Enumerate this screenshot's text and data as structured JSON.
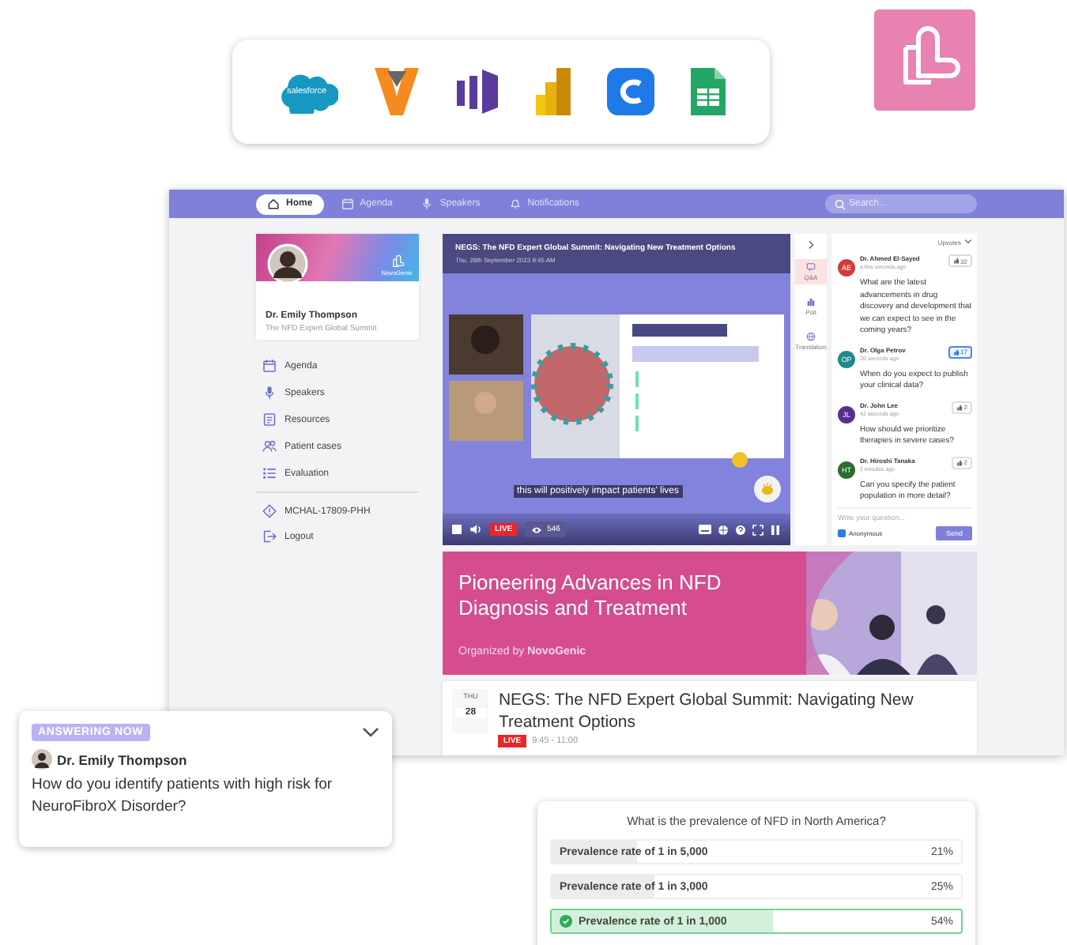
{
  "integrations": {
    "logo_text": "salesforce"
  },
  "app": {
    "nav": [
      {
        "label": "Home",
        "kind": "home",
        "selected": true
      },
      {
        "label": "Agenda",
        "kind": "calendar",
        "selected": false
      },
      {
        "label": "Speakers",
        "kind": "mic",
        "selected": false
      },
      {
        "label": "Notifications",
        "kind": "bell",
        "selected": false
      }
    ],
    "search": {
      "placeholder": "Search..."
    },
    "profile": {
      "brand": "NovoGenic",
      "name": "Dr. Emily Thompson",
      "event": "The NFD Expert Global Summit"
    },
    "menu": [
      {
        "label": "Agenda",
        "kind": "calendar"
      },
      {
        "label": "Speakers",
        "kind": "mic"
      },
      {
        "label": "Resources",
        "kind": "doc"
      },
      {
        "label": "Patient cases",
        "kind": "people"
      },
      {
        "label": "Evaluation",
        "kind": "list"
      }
    ],
    "code": "MCHAL-17809-PHH",
    "logout": "Logout",
    "player": {
      "title": "NEGS: The NFD Expert Global Summit: Navigating New Treatment Options",
      "date": "Thu, 28th September 2023 9:45 AM",
      "caption": "this will positively impact patients' lives",
      "live": "LIVE",
      "viewers": "546"
    },
    "rail": [
      {
        "label": "Q&A",
        "kind": "qa",
        "selected": true
      },
      {
        "label": "Poll",
        "kind": "poll",
        "selected": false
      },
      {
        "label": "Translation",
        "kind": "globe",
        "selected": false
      }
    ],
    "qa": {
      "sort": "Upvotes",
      "questions": [
        {
          "initials": "AE",
          "color": "#d23b3b",
          "name": "Dr. Ahmed El-Sayed",
          "time": "a few seconds ago",
          "text": "What are the latest advancements in drug discovery and development that we can expect to see in the coming years?",
          "votes": "32",
          "voted": false
        },
        {
          "initials": "OP",
          "color": "#1f8a8a",
          "name": "Dr. Olga Petrov",
          "time": "20 seconds ago",
          "text": "When do you expect to publish your clinical data?",
          "votes": "17",
          "voted": true
        },
        {
          "initials": "JL",
          "color": "#5a2d91",
          "name": "Dr. John Lee",
          "time": "42 seconds ago",
          "text": "How should we prioritize therapies in severe cases?",
          "votes": "2",
          "voted": false
        },
        {
          "initials": "HT",
          "color": "#2e6b2e",
          "name": "Dr. Hiroshi Tanaka",
          "time": "2 minutes ago",
          "text": "Can you specify the patient population in more detail?",
          "votes": "2",
          "voted": false
        }
      ],
      "placeholder": "Write your question...",
      "anonymous": {
        "label": "Anonymous",
        "checked": true
      },
      "send": "Send"
    },
    "banner": {
      "title": "Pioneering Advances in NFD Diagnosis and Treatment",
      "organizer": "Organized by **NovoGenic**"
    },
    "session": {
      "day": "THU",
      "date": "28",
      "title": "NEGS: The NFD Expert Global Summit: Navigating New Treatment Options",
      "live": "LIVE",
      "time": "9:45 - 11:00"
    }
  },
  "answering": {
    "badge": "ANSWERING NOW",
    "name": "Dr. Emily Thompson",
    "question": "How do you identify patients with high risk for NeuroFibroX Disorder?"
  },
  "poll": {
    "question": "What is the prevalence of NFD in North America?",
    "options": [
      {
        "label": "Prevalence rate of 1 in 5,000",
        "percent": "21%",
        "level": 0.21,
        "selected": false
      },
      {
        "label": "Prevalence rate of 1 in 3,000",
        "percent": "25%",
        "level": 0.25,
        "selected": false
      },
      {
        "label": "Prevalence rate of 1 in 1,000",
        "percent": "54%",
        "level": 0.54,
        "selected": true
      }
    ]
  }
}
